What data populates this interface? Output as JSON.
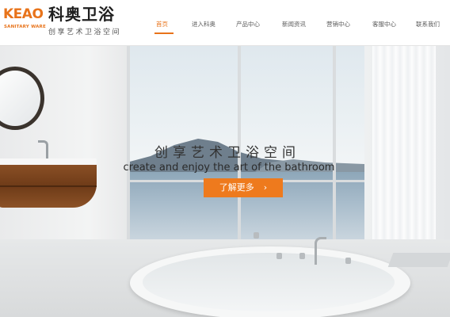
{
  "brand": {
    "logo_letters": "KEAO",
    "logo_sub": "SANITARY WARE",
    "name": "科奥卫浴",
    "slogan": "创享艺术卫浴空间"
  },
  "nav": {
    "items": [
      "首页",
      "进入科奥",
      "产品中心",
      "新闻资讯",
      "营销中心",
      "客服中心",
      "联系我们"
    ],
    "active_index": 0
  },
  "hero": {
    "title": "创享艺术卫浴空间",
    "subtitle": "create and enjoy the art of the bathroom",
    "cta_label": "了解更多",
    "cta_chevron": "›"
  },
  "colors": {
    "accent": "#ee7a1d",
    "cabinet_wood": "#7a4420"
  }
}
